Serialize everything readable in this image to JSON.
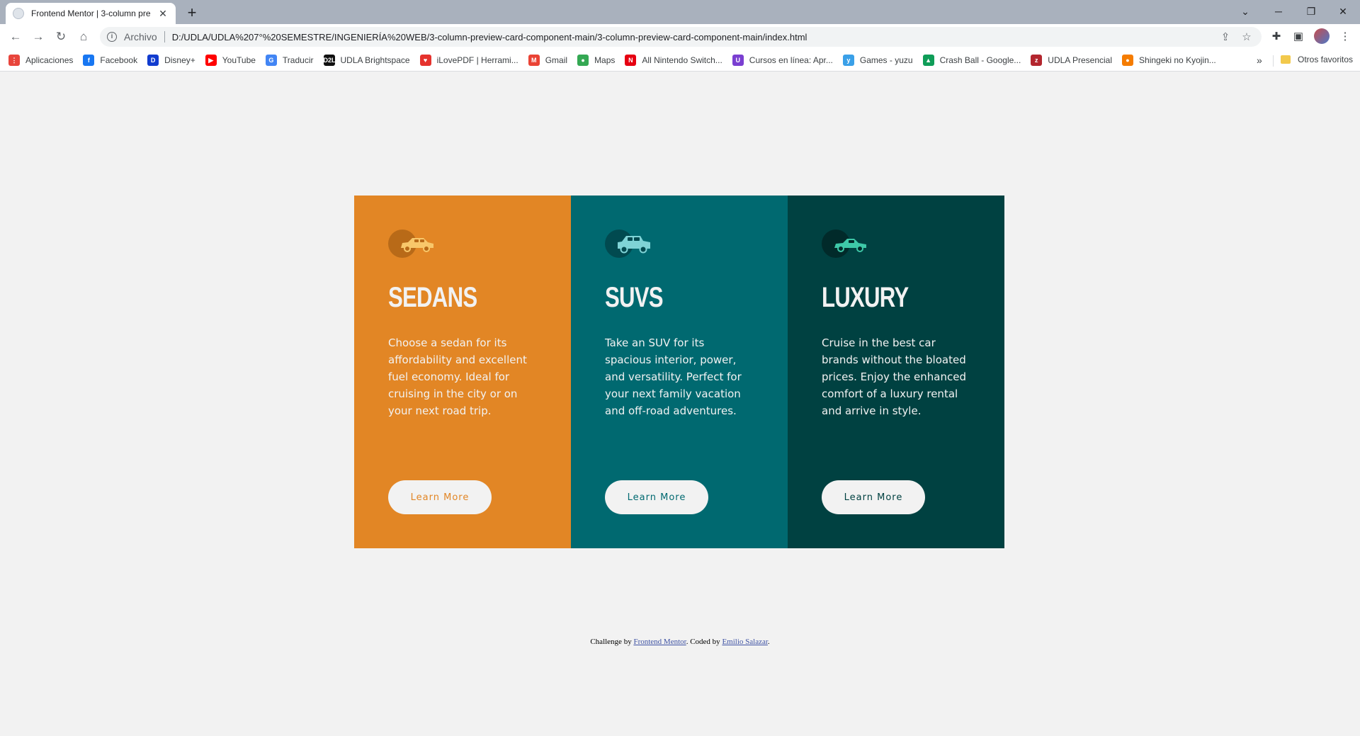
{
  "browser": {
    "tab_title": "Frontend Mentor | 3-column pre",
    "tab_close": "✕",
    "new_tab": "+",
    "window_controls": [
      "⌄",
      "─",
      "❐",
      "✕"
    ],
    "nav": {
      "back": "←",
      "forward": "→",
      "reload": "↻",
      "home": "⌂"
    },
    "omnibox": {
      "info": "i",
      "scheme_label": "Archivo",
      "url": "D:/UDLA/UDLA%207°%20SEMESTRE/INGENIERÍA%20WEB/3-column-preview-card-component-main/3-column-preview-card-component-main/index.html",
      "share_icon": "⇪",
      "star_icon": "☆"
    },
    "toolbar_icons": {
      "extensions": "✚",
      "sidebar": "▣",
      "menu": "⋮"
    },
    "bookmarks": [
      {
        "label": "Aplicaciones",
        "color": "#e8453c",
        "glyph": "⋮"
      },
      {
        "label": "Facebook",
        "color": "#1877f2",
        "glyph": "f"
      },
      {
        "label": "Disney+",
        "color": "#113ccf",
        "glyph": "D"
      },
      {
        "label": "YouTube",
        "color": "#ff0000",
        "glyph": "▶"
      },
      {
        "label": "Traducir",
        "color": "#4285f4",
        "glyph": "G"
      },
      {
        "label": "UDLA Brightspace",
        "color": "#111111",
        "glyph": "D2L"
      },
      {
        "label": "iLovePDF | Herrami...",
        "color": "#e5322d",
        "glyph": "♥"
      },
      {
        "label": "Gmail",
        "color": "#ea4335",
        "glyph": "M"
      },
      {
        "label": "Maps",
        "color": "#34a853",
        "glyph": "●"
      },
      {
        "label": "All Nintendo Switch...",
        "color": "#e60012",
        "glyph": "N"
      },
      {
        "label": "Cursos en línea: Apr...",
        "color": "#7a3fd1",
        "glyph": "U"
      },
      {
        "label": "Games - yuzu",
        "color": "#3aa0e8",
        "glyph": "y"
      },
      {
        "label": "Crash Ball - Google...",
        "color": "#0f9d58",
        "glyph": "▲"
      },
      {
        "label": "UDLA Presencial",
        "color": "#b3262e",
        "glyph": "z"
      },
      {
        "label": "Shingeki no Kyojin...",
        "color": "#f57c00",
        "glyph": "●"
      }
    ],
    "bookmarks_more": "»",
    "other_bookmarks": "Otros favoritos"
  },
  "cards": [
    {
      "title": "SEDANS",
      "text": "Choose a sedan for its affordability and excellent fuel economy. Ideal for cruising in the city or on your next road trip.",
      "button": "Learn More",
      "bg": "#e28625",
      "accent": "#e28625",
      "icon_circle": "#b86a18",
      "icon_color": "#f8c76a"
    },
    {
      "title": "SUVS",
      "text": "Take an SUV for its spacious interior, power, and versatility. Perfect for your next family vacation and off-road adventures.",
      "button": "Learn More",
      "bg": "#006970",
      "accent": "#006970",
      "icon_circle": "#014a50",
      "icon_color": "#7fd3d6"
    },
    {
      "title": "LUXURY",
      "text": "Cruise in the best car brands without the bloated prices. Enjoy the enhanced comfort of a luxury rental and arrive in style.",
      "button": "Learn More",
      "bg": "#004141",
      "accent": "#004141",
      "icon_circle": "#012a2a",
      "icon_color": "#3ec8a8"
    }
  ],
  "attribution": {
    "prefix": "Challenge by ",
    "link1": "Frontend Mentor",
    "middle": ". Coded by ",
    "link2": "Emilio Salazar",
    "suffix": "."
  }
}
